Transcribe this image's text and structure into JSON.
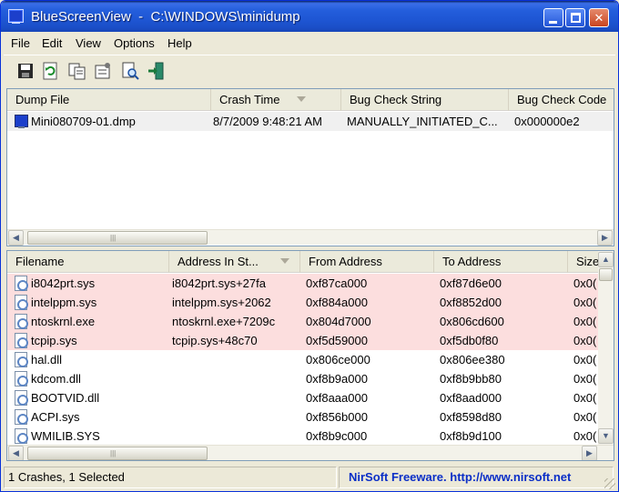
{
  "window": {
    "title": "BlueScreenView  -  C:\\WINDOWS\\minidump"
  },
  "menu": [
    "File",
    "Edit",
    "View",
    "Options",
    "Help"
  ],
  "toolbar": {
    "buttons": [
      "save-icon",
      "refresh-icon",
      "copy-icon",
      "properties-icon",
      "find-icon",
      "exit-icon"
    ]
  },
  "dumps": {
    "columns": [
      "Dump File",
      "Crash Time",
      "Bug Check String",
      "Bug Check Code"
    ],
    "rows": [
      {
        "dump_file": "Mini080709-01.dmp",
        "crash_time": "8/7/2009 9:48:21 AM",
        "bug_check_string": "MANUALLY_INITIATED_C...",
        "bug_check_code": "0x000000e2"
      }
    ]
  },
  "drivers": {
    "columns": [
      "Filename",
      "Address In St...",
      "From Address",
      "To Address",
      "Size"
    ],
    "rows": [
      {
        "filename": "i8042prt.sys",
        "address_in_stack": "i8042prt.sys+27fa",
        "from": "0xf87ca000",
        "to": "0xf87d6e00",
        "size": "0x0(",
        "highlight": true
      },
      {
        "filename": "intelppm.sys",
        "address_in_stack": "intelppm.sys+2062",
        "from": "0xf884a000",
        "to": "0xf8852d00",
        "size": "0x0(",
        "highlight": true
      },
      {
        "filename": "ntoskrnl.exe",
        "address_in_stack": "ntoskrnl.exe+7209c",
        "from": "0x804d7000",
        "to": "0x806cd600",
        "size": "0x0(",
        "highlight": true
      },
      {
        "filename": "tcpip.sys",
        "address_in_stack": "tcpip.sys+48c70",
        "from": "0xf5d59000",
        "to": "0xf5db0f80",
        "size": "0x0(",
        "highlight": true
      },
      {
        "filename": "hal.dll",
        "address_in_stack": "",
        "from": "0x806ce000",
        "to": "0x806ee380",
        "size": "0x0(",
        "highlight": false
      },
      {
        "filename": "kdcom.dll",
        "address_in_stack": "",
        "from": "0xf8b9a000",
        "to": "0xf8b9bb80",
        "size": "0x0(",
        "highlight": false
      },
      {
        "filename": "BOOTVID.dll",
        "address_in_stack": "",
        "from": "0xf8aaa000",
        "to": "0xf8aad000",
        "size": "0x0(",
        "highlight": false
      },
      {
        "filename": "ACPI.sys",
        "address_in_stack": "",
        "from": "0xf856b000",
        "to": "0xf8598d80",
        "size": "0x0(",
        "highlight": false
      },
      {
        "filename": "WMILIB.SYS",
        "address_in_stack": "",
        "from": "0xf8b9c000",
        "to": "0xf8b9d100",
        "size": "0x0(",
        "highlight": false
      }
    ]
  },
  "status": {
    "left": "1 Crashes, 1 Selected",
    "right": "NirSoft Freeware.  http://www.nirsoft.net"
  },
  "colors": {
    "highlight_row": "#fcdede",
    "title_bar": "#245edc",
    "link": "#0a2ec7"
  }
}
